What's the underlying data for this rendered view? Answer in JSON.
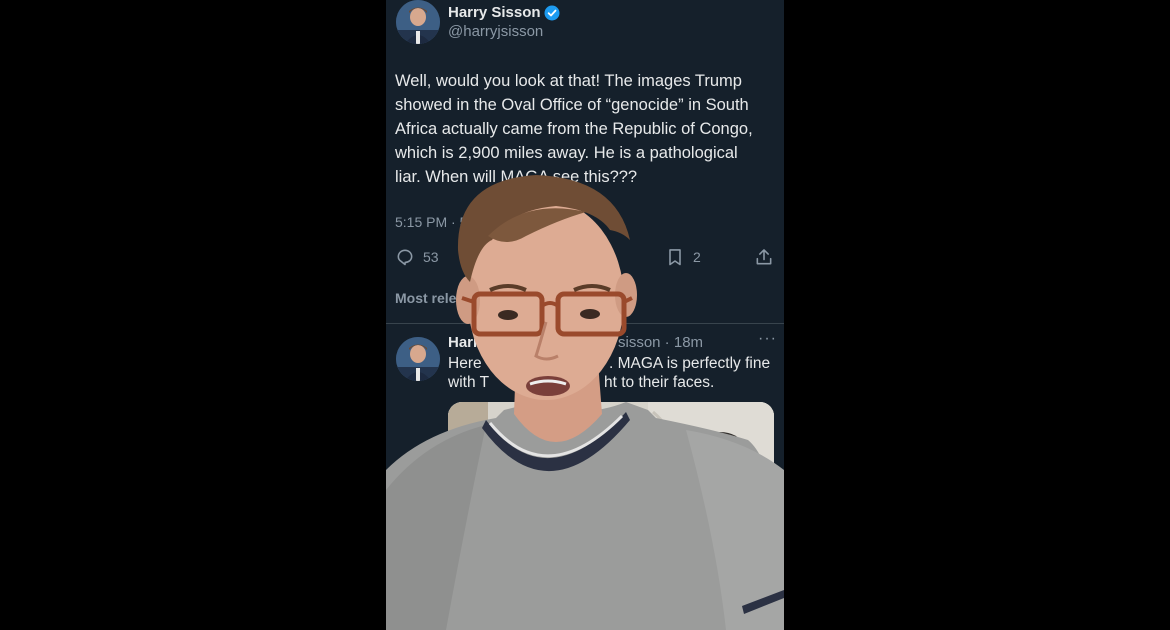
{
  "tweet": {
    "author_name": "Harry Sisson",
    "author_handle": "@harryjsisson",
    "text_lines": [
      "Well, would you look at that! The images Trump",
      "showed in the Oval Office of “genocide” in South",
      "Africa actually came from the Republic of Congo,",
      "which is 2,900 miles away. He is a pathological",
      "liar. When will MAGA see this???"
    ],
    "timestamp": "5:15 PM · 5/",
    "reply_count": "53",
    "bookmark_count": "2",
    "icons": {
      "reply": "reply-icon",
      "bookmark": "bookmark-icon",
      "share": "share-icon",
      "verified": "verified-badge-icon"
    }
  },
  "replies_section": {
    "label": "Most rele"
  },
  "reply": {
    "author_name": "Harr",
    "handle_time": "sisson · 18m",
    "more": "···",
    "line1_start": "Here",
    "line1_end": ". MAGA is perfectly fine",
    "line2_start": "with T",
    "line2_end": "ht to their faces."
  },
  "colors": {
    "background": "#15202b",
    "text": "#e7e9ea",
    "muted": "#8b98a5",
    "verified": "#1d9bf0",
    "divider": "#38444d"
  }
}
